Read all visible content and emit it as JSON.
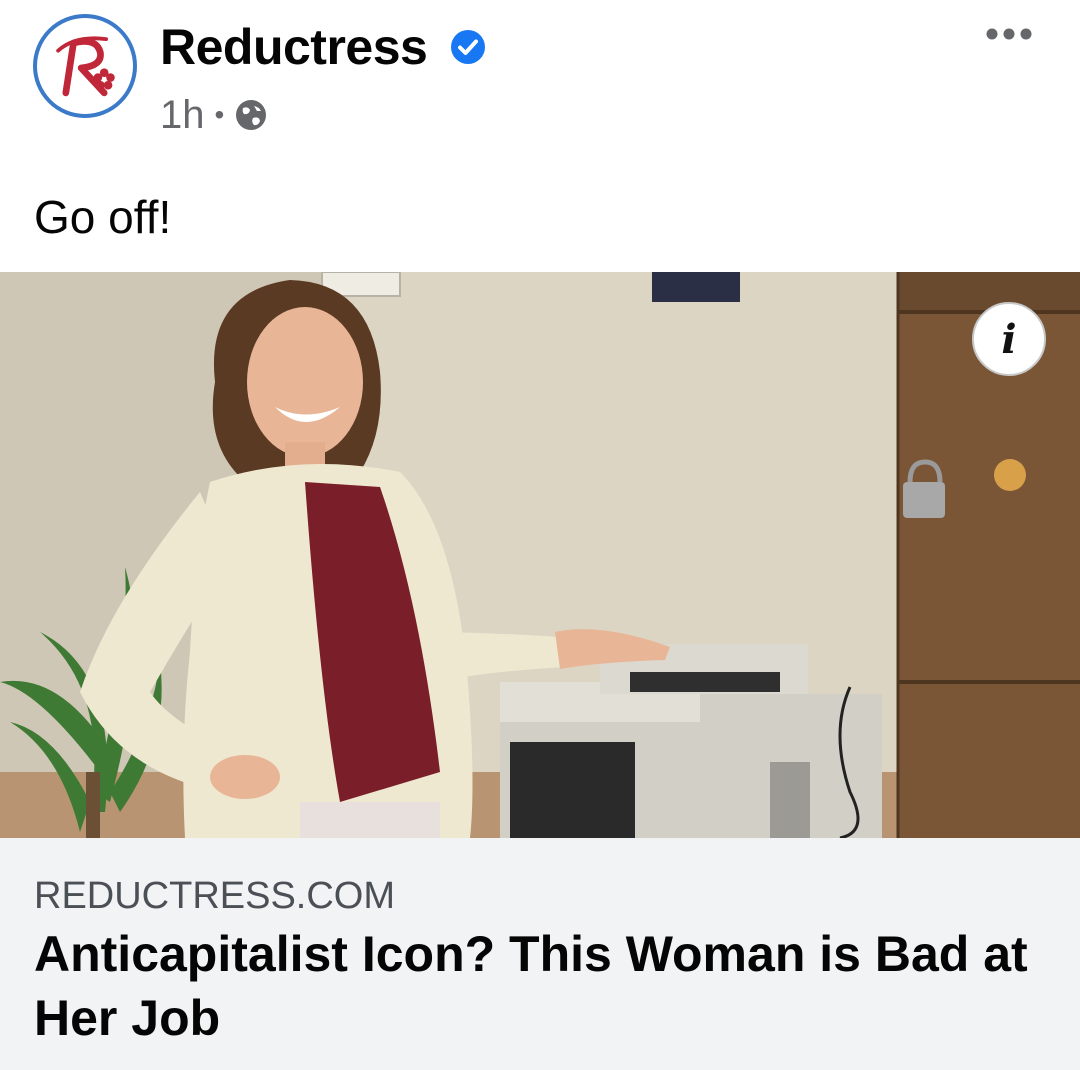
{
  "post": {
    "page_name": "Reductress",
    "verified_icon": "verified-badge-icon",
    "time": "1h",
    "separator": "•",
    "audience_icon": "globe-icon",
    "caption": "Go off!",
    "more_icon": "more-options-icon"
  },
  "media": {
    "info_glyph": "i"
  },
  "link_preview": {
    "domain": "REDUCTRESS.COM",
    "title": "Anticapitalist Icon? This Woman is Bad at Her Job"
  },
  "colors": {
    "verified_blue": "#1877f2",
    "brand_red": "#c0283a",
    "meta_gray": "#65676b",
    "link_bg": "#f2f3f5"
  }
}
